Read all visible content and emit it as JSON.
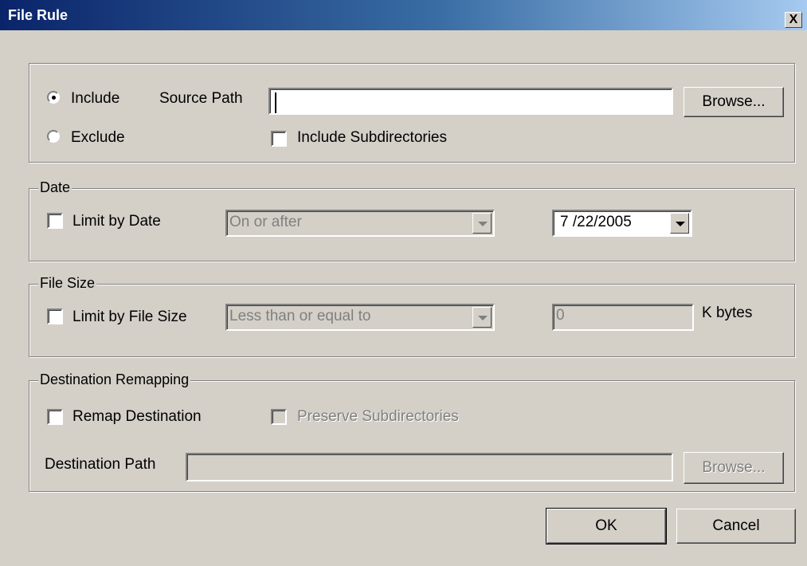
{
  "window": {
    "title": "File Rule",
    "close_label": "X"
  },
  "source": {
    "include_label": "Include",
    "exclude_label": "Exclude",
    "include_selected": true,
    "path_label": "Source Path",
    "path_value": "",
    "browse_label": "Browse...",
    "subdirs_label": "Include Subdirectories",
    "subdirs_checked": false
  },
  "date": {
    "group_label": "Date",
    "limit_label": "Limit by Date",
    "limit_checked": false,
    "condition": "On or after",
    "value": "7 /22/2005"
  },
  "filesize": {
    "group_label": "File Size",
    "limit_label": "Limit by File Size",
    "limit_checked": false,
    "condition": "Less than or equal to",
    "value": "0",
    "unit": "K bytes"
  },
  "remap": {
    "group_label": "Destination Remapping",
    "remap_label": "Remap Destination",
    "remap_checked": false,
    "preserve_label": "Preserve Subdirectories",
    "path_label": "Destination Path",
    "path_value": "",
    "browse_label": "Browse..."
  },
  "buttons": {
    "ok": "OK",
    "cancel": "Cancel"
  }
}
